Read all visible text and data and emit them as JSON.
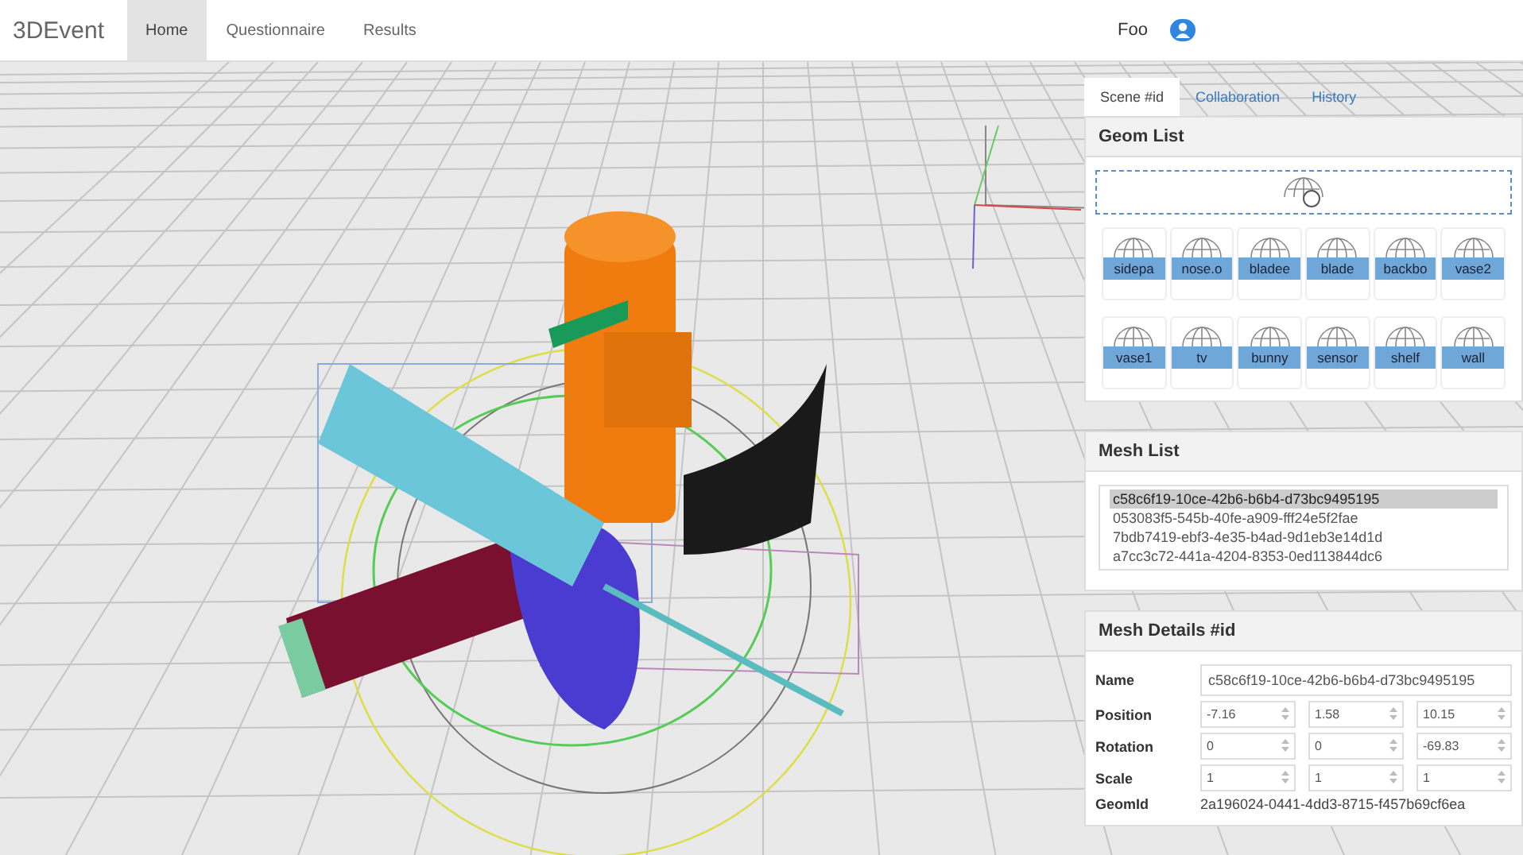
{
  "navbar": {
    "brand": "3DEvent",
    "items": [
      {
        "label": "Home",
        "selected": true
      },
      {
        "label": "Questionnaire",
        "selected": false
      },
      {
        "label": "Results",
        "selected": false
      }
    ],
    "user": "Foo"
  },
  "side_panel": {
    "tabs": [
      {
        "label": "Scene #id",
        "selected": true
      },
      {
        "label": "Collaboration",
        "selected": false
      },
      {
        "label": "History",
        "selected": false
      }
    ],
    "geom_list": {
      "title": "Geom List",
      "items": [
        "sidepa",
        "nose.o",
        "bladee",
        "blade",
        "backbo",
        "vase2",
        "vase1",
        "tv",
        "bunny",
        "sensor",
        "shelf",
        "wall"
      ]
    },
    "mesh_list": {
      "title": "Mesh List",
      "items": [
        {
          "id": "c58c6f19-10ce-42b6-b6b4-d73bc9495195",
          "selected": true
        },
        {
          "id": "053083f5-545b-40fe-a909-fff24e5f2fae",
          "selected": false
        },
        {
          "id": "7bdb7419-ebf3-4e35-b4ad-9d1eb3e14d1d",
          "selected": false
        },
        {
          "id": "a7cc3c72-441a-4204-8353-0ed113844dc6",
          "selected": false
        }
      ]
    },
    "mesh_details": {
      "title": "Mesh Details #id",
      "name_label": "Name",
      "name": "c58c6f19-10ce-42b6-b6b4-d73bc9495195",
      "rows": [
        {
          "label": "Position",
          "values": [
            "-7.16",
            "1.58",
            "10.15"
          ]
        },
        {
          "label": "Rotation",
          "values": [
            "0",
            "0",
            "-69.83"
          ]
        },
        {
          "label": "Scale",
          "values": [
            "1",
            "1",
            "1"
          ]
        }
      ],
      "geom_label": "GeomId",
      "geom_id": "2a196024-0441-4dd3-8715-f457b69cf6ea"
    }
  }
}
